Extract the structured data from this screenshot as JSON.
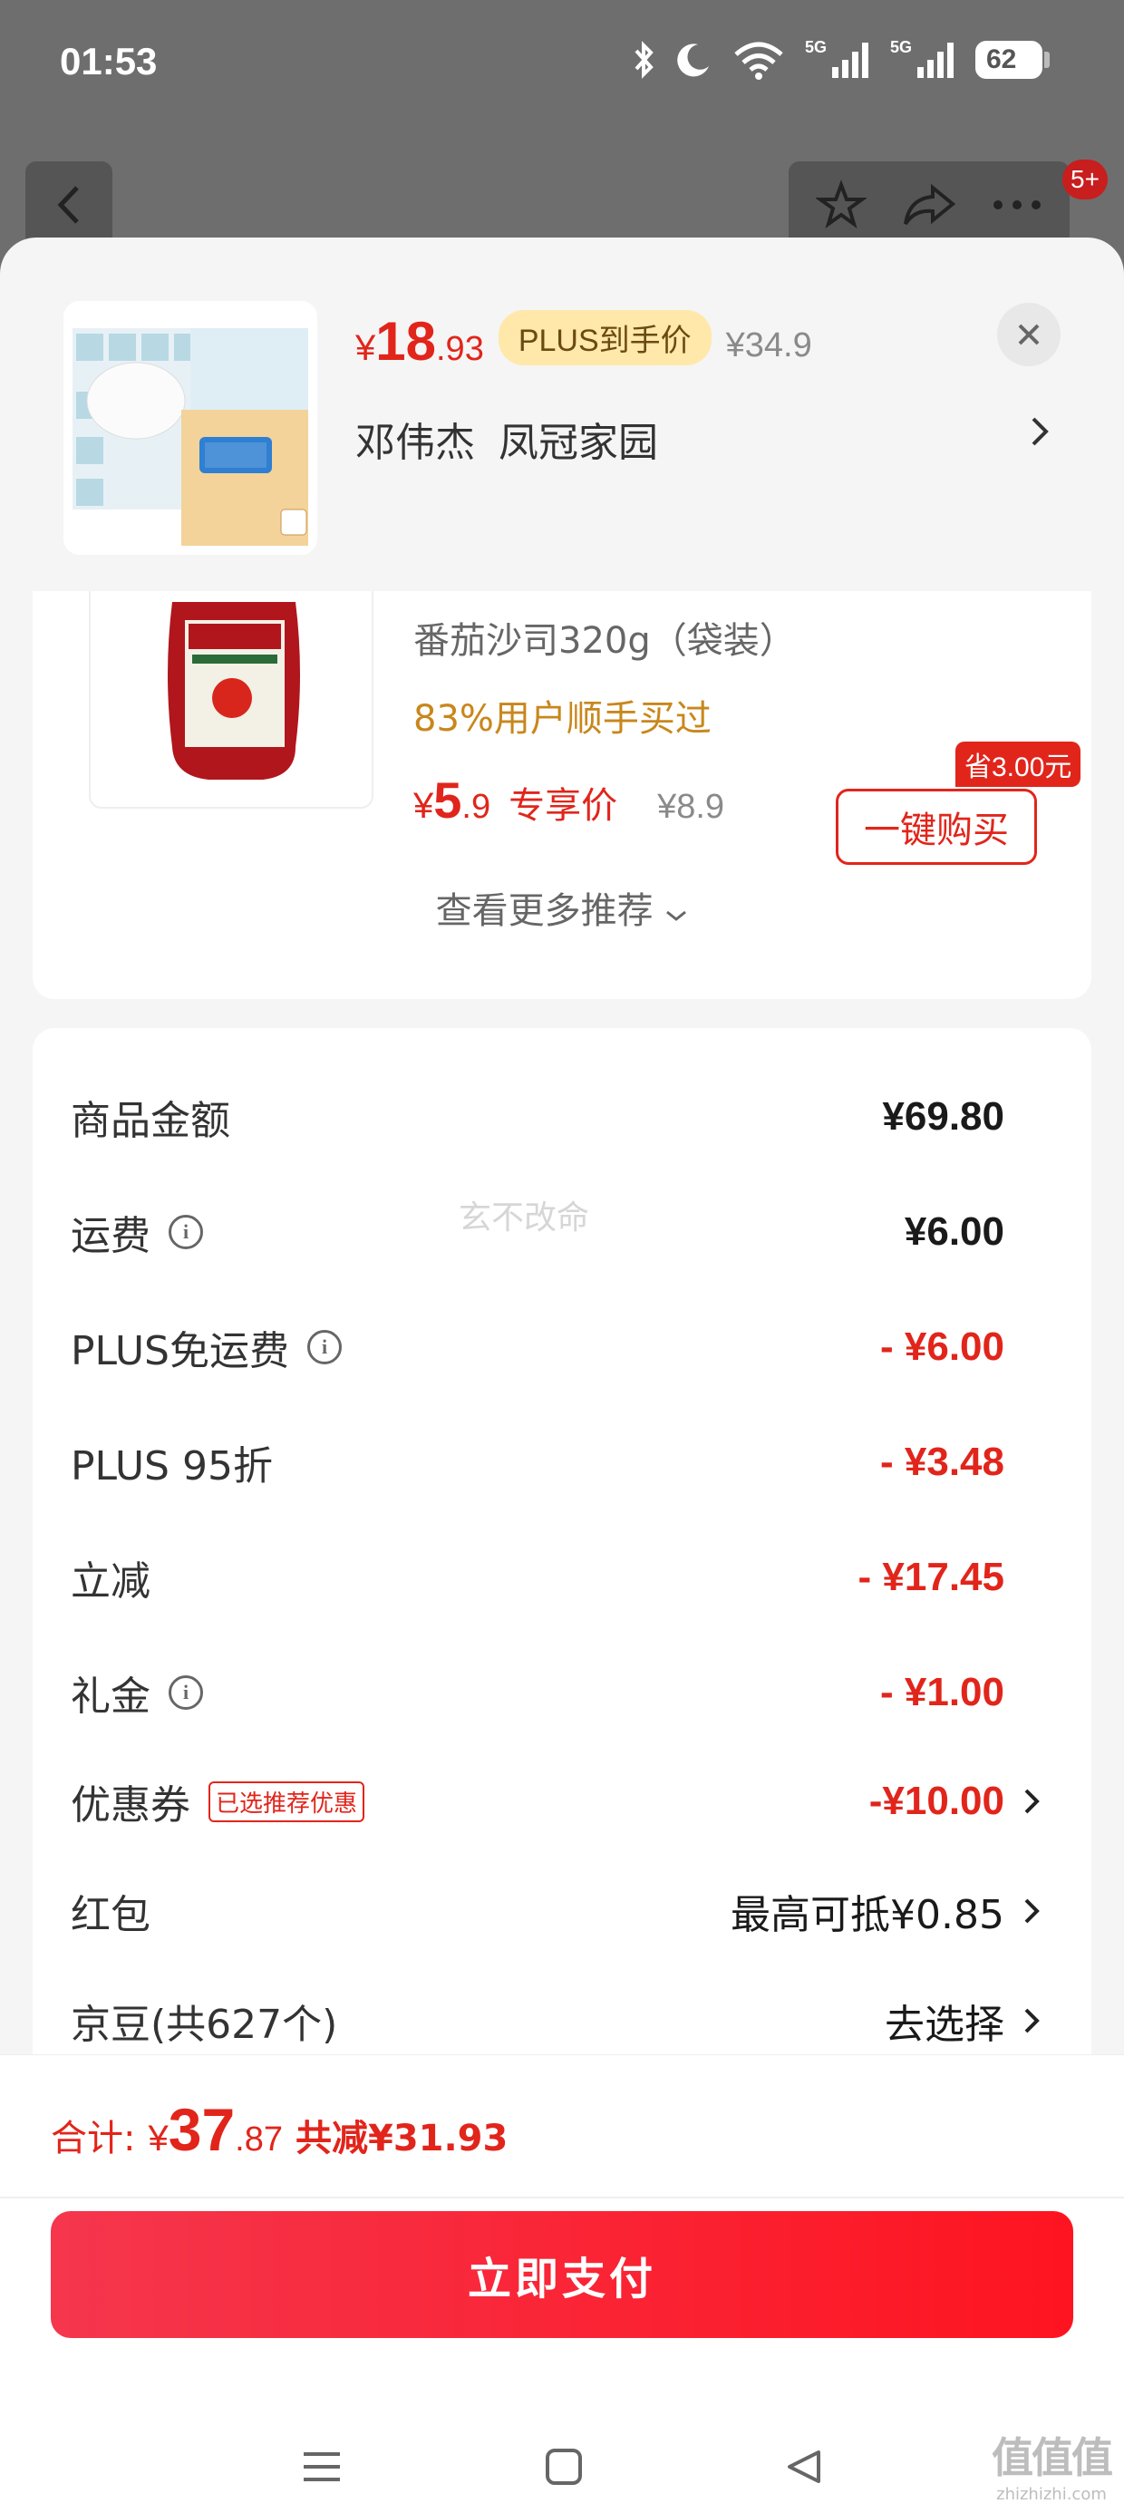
{
  "status_bar": {
    "time": "01:53",
    "sig1": "5G",
    "sig2": "5G",
    "battery": "62"
  },
  "page_header": {
    "badge": "5+"
  },
  "product": {
    "price_yen": "¥",
    "price_int": "18",
    "price_dec": ".93",
    "plus_tag": "PLUS到手价",
    "original_price": "¥34.9",
    "address": "邓伟杰 凤冠家园"
  },
  "recommendation": {
    "name": "番茄沙司320g（袋装）",
    "bought": "83%用户顺手买过",
    "price_yen": "¥",
    "price_int": "5",
    "price_dec": ".9",
    "exclusive": "专享价",
    "original_price": "¥8.9",
    "save_badge": "省3.00元",
    "buy_label": "一键购买",
    "see_more": "查看更多推荐"
  },
  "summary": {
    "items": [
      {
        "label": "商品金额",
        "value": "¥69.80"
      },
      {
        "label": "运费",
        "value": "¥6.00"
      },
      {
        "label": "PLUS免运费",
        "value": "- ¥6.00"
      },
      {
        "label": "PLUS 95折",
        "value": "- ¥3.48"
      },
      {
        "label": "立减",
        "value": "- ¥17.45"
      },
      {
        "label": "礼金",
        "value": "- ¥1.00"
      },
      {
        "label": "优惠券",
        "tag": "已选推荐优惠",
        "value": "-¥10.00"
      },
      {
        "label": "红包",
        "value": "最高可抵¥0.85"
      },
      {
        "label": "京豆(共627个)",
        "value": "去选择"
      }
    ],
    "watermark": "玄不改命"
  },
  "footer": {
    "total_label": "合计:",
    "total_yen": "¥",
    "total_int": "37",
    "total_dec": ".87",
    "total_saved": "共减¥31.93",
    "pay_label": "立即支付"
  },
  "site_mark": {
    "big": "值值值",
    "small": "zhizhizhi.com"
  },
  "colors": {
    "accent_red": "#e1251b",
    "plus_gold": "#ffe8a9",
    "bought_orange": "#c8871c"
  }
}
